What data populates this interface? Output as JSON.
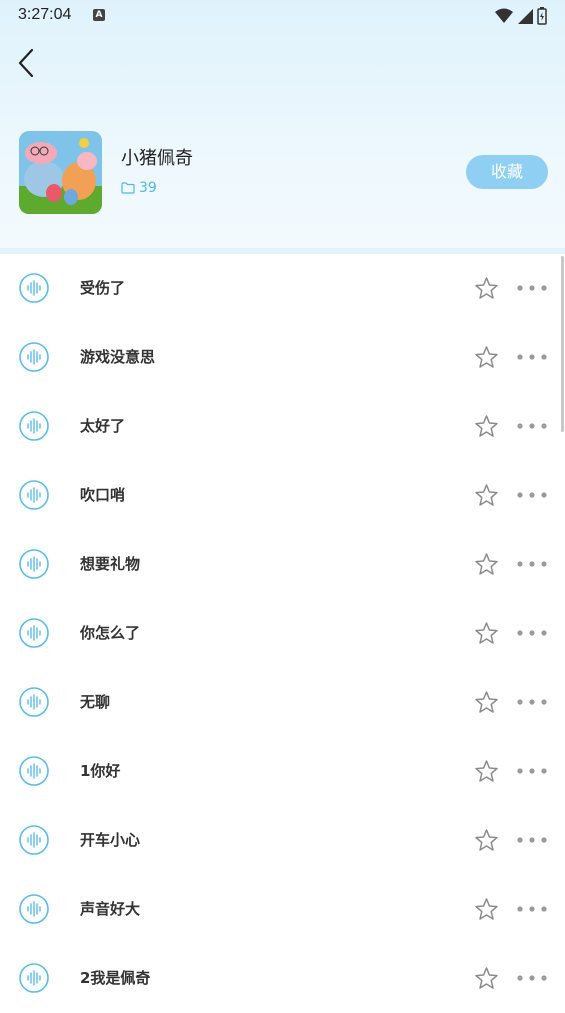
{
  "status_bar": {
    "time": "3:27:04",
    "notification_badge": "A"
  },
  "header": {
    "album_title": "小猪佩奇",
    "album_count": "39",
    "collect_label": "收藏"
  },
  "tracks": [
    {
      "title": "受伤了"
    },
    {
      "title": "游戏没意思"
    },
    {
      "title": "太好了"
    },
    {
      "title": "吹口哨"
    },
    {
      "title": "想要礼物"
    },
    {
      "title": "你怎么了"
    },
    {
      "title": "无聊"
    },
    {
      "title": "1你好"
    },
    {
      "title": "开车小心"
    },
    {
      "title": "声音好大"
    },
    {
      "title": "2我是佩奇"
    }
  ],
  "colors": {
    "accent": "#4fb6ec",
    "button": "#8ecff3",
    "header_bg": "#e6f5fc"
  },
  "icons": {
    "back": "chevron-left-icon",
    "folder": "folder-icon",
    "play": "audio-wave-icon",
    "favorite": "star-outline-icon",
    "more": "more-dots-icon"
  }
}
